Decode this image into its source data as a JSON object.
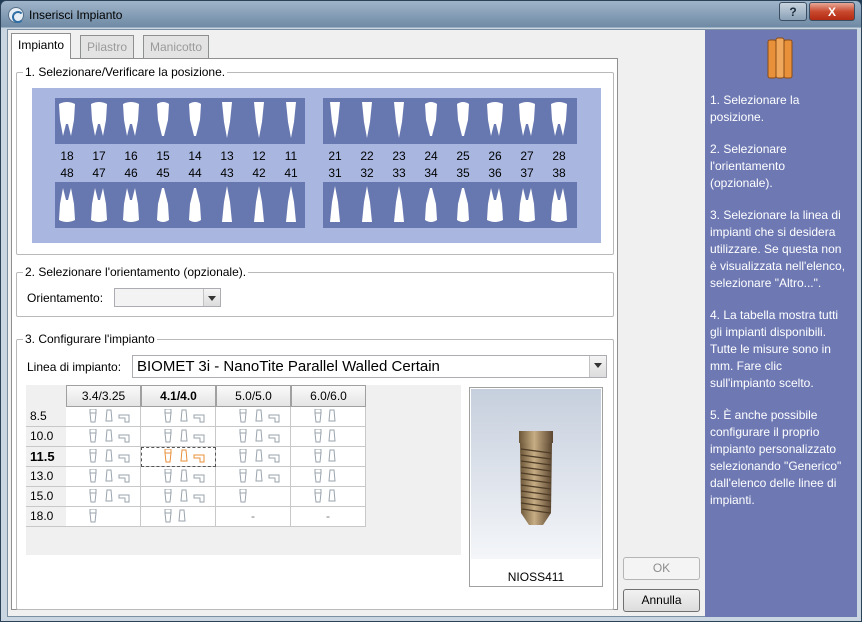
{
  "window": {
    "title": "Inserisci Impianto",
    "help_label": "?",
    "close_label": "X"
  },
  "tabs": [
    {
      "label": "Impianto",
      "active": true
    },
    {
      "label": "Pilastro",
      "active": false
    },
    {
      "label": "Manicotto",
      "active": false
    }
  ],
  "section1": {
    "label": "1. Selezionare/Verificare la posizione.",
    "upper_left": [
      "18",
      "17",
      "16",
      "15",
      "14",
      "13",
      "12",
      "11"
    ],
    "upper_right": [
      "21",
      "22",
      "23",
      "24",
      "25",
      "26",
      "27",
      "28"
    ],
    "lower_left": [
      "48",
      "47",
      "46",
      "45",
      "44",
      "43",
      "42",
      "41"
    ],
    "lower_right": [
      "31",
      "32",
      "33",
      "34",
      "35",
      "36",
      "37",
      "38"
    ]
  },
  "section2": {
    "label": "2. Selezionare l'orientamento (opzionale).",
    "field_label": "Orientamento:",
    "value": ""
  },
  "section3": {
    "label": "3. Configurare l'impianto",
    "line_label": "Linea di impianto:",
    "line_value": "BIOMET 3i - NanoTite Parallel Walled Certain",
    "columns": [
      "3.4/3.25",
      "4.1/4.0",
      "5.0/5.0",
      "6.0/6.0"
    ],
    "selected_column": "4.1/4.0",
    "rows": [
      {
        "length": "8.5",
        "cells": [
          "full",
          "full",
          "full",
          "two"
        ]
      },
      {
        "length": "10.0",
        "cells": [
          "full",
          "full",
          "full",
          "two"
        ]
      },
      {
        "length": "11.5",
        "cells": [
          "full",
          "full",
          "full",
          "two"
        ]
      },
      {
        "length": "13.0",
        "cells": [
          "full",
          "full",
          "full",
          "two"
        ]
      },
      {
        "length": "15.0",
        "cells": [
          "full",
          "full",
          "one",
          "two"
        ]
      },
      {
        "length": "18.0",
        "cells": [
          "one",
          "two",
          "-",
          "-"
        ]
      }
    ],
    "selected_row": "11.5",
    "preview_code": "NIOSS411"
  },
  "buttons": {
    "ok": "OK",
    "cancel": "Annulla"
  },
  "help": {
    "steps": [
      "1. Selezionare la posizione.",
      "2. Selezionare l'orientamento (opzionale).",
      "3. Selezionare la linea di impianti che si desidera utilizzare. Se questa non è visualizzata nell'elenco, selezionare \"Altro...\".",
      "4. La tabella mostra tutti gli impianti disponibili. Tutte le misure sono in mm. Fare clic sull'impianto scelto.",
      "5. È anche possibile configurare il proprio impianto personalizzato selezionando \"Generico\" dall'elenco delle linee di impianti."
    ]
  },
  "colors": {
    "help_bg": "#6e79b4",
    "arch_bg": "#6777b0",
    "teeth_bg": "#a8b6e0",
    "selected_icon": "#e8903a"
  }
}
